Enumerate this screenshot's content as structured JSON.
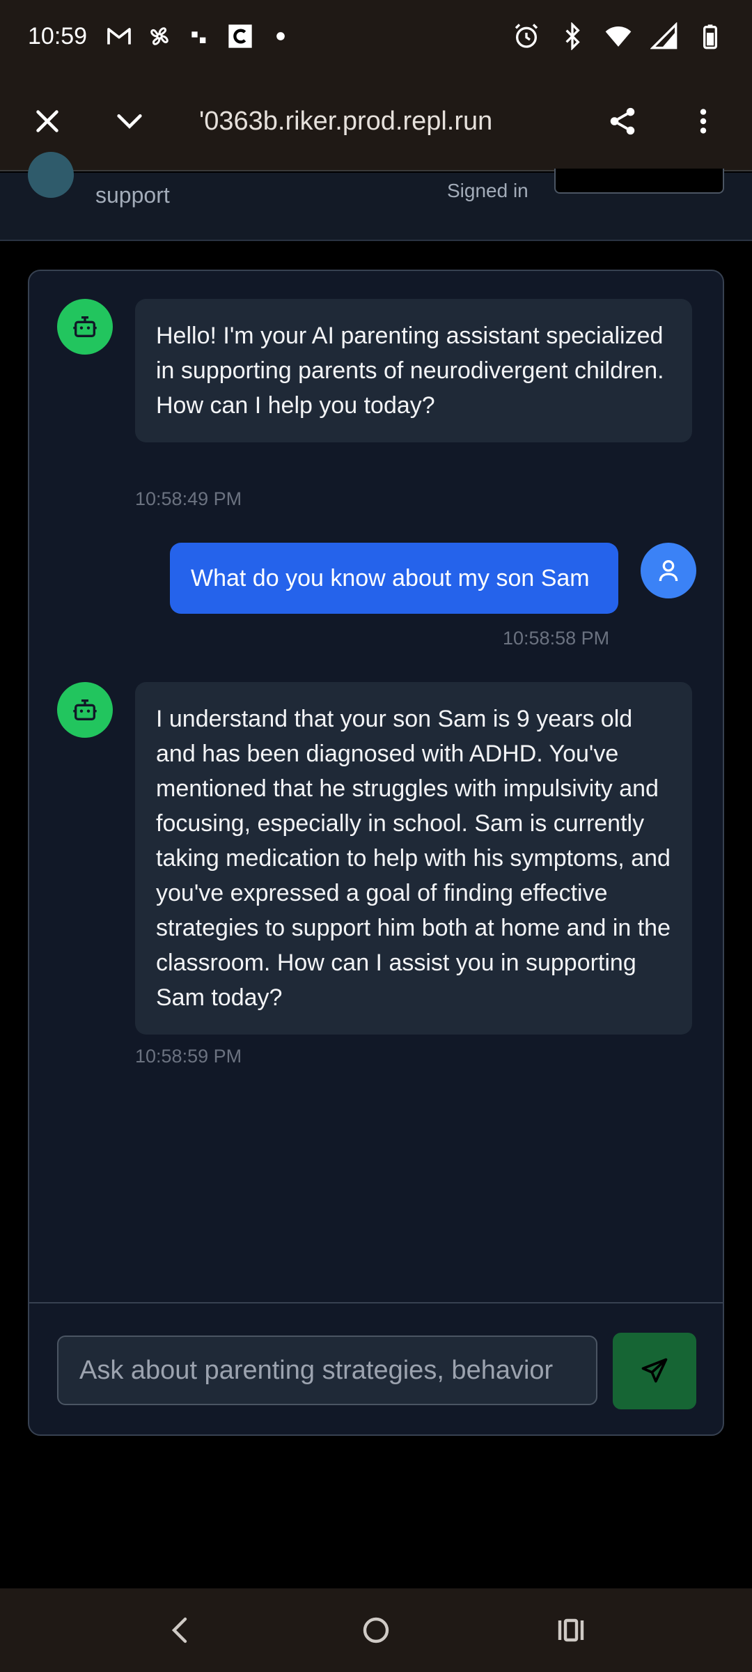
{
  "status_bar": {
    "time": "10:59",
    "left_icons": [
      "gmail-icon",
      "pinwheel-icon",
      "app-dots-icon",
      "c-app-icon",
      "notification-dot-icon"
    ],
    "right_icons": [
      "alarm-icon",
      "bluetooth-icon",
      "wifi-icon",
      "signal-icon",
      "battery-icon"
    ]
  },
  "browser": {
    "url": "'0363b.riker.prod.repl.run"
  },
  "app_header": {
    "subtitle": "support",
    "status": "Signed in"
  },
  "messages": [
    {
      "role": "assistant",
      "text": "Hello! I'm your AI parenting assistant specialized in supporting parents of neurodivergent children. How can I help you today?",
      "time": "10:58:49 PM"
    },
    {
      "role": "user",
      "text": "What do you know about my son Sam",
      "time": "10:58:58 PM"
    },
    {
      "role": "assistant",
      "text": "I understand that your son Sam is 9 years old and has been diagnosed with ADHD. You've mentioned that he struggles with impulsivity and focusing, especially in school. Sam is currently taking medication to help with his symptoms, and you've expressed a goal of finding effective strategies to support him both at home and in the classroom. How can I assist you in supporting Sam today?",
      "time": "10:58:59 PM"
    }
  ],
  "composer": {
    "placeholder": "Ask about parenting strategies, behavior",
    "value": ""
  },
  "colors": {
    "bot_avatar": "#22c55e",
    "user_bubble": "#2563eb",
    "send_button": "#166534",
    "card_bg": "#111827"
  }
}
